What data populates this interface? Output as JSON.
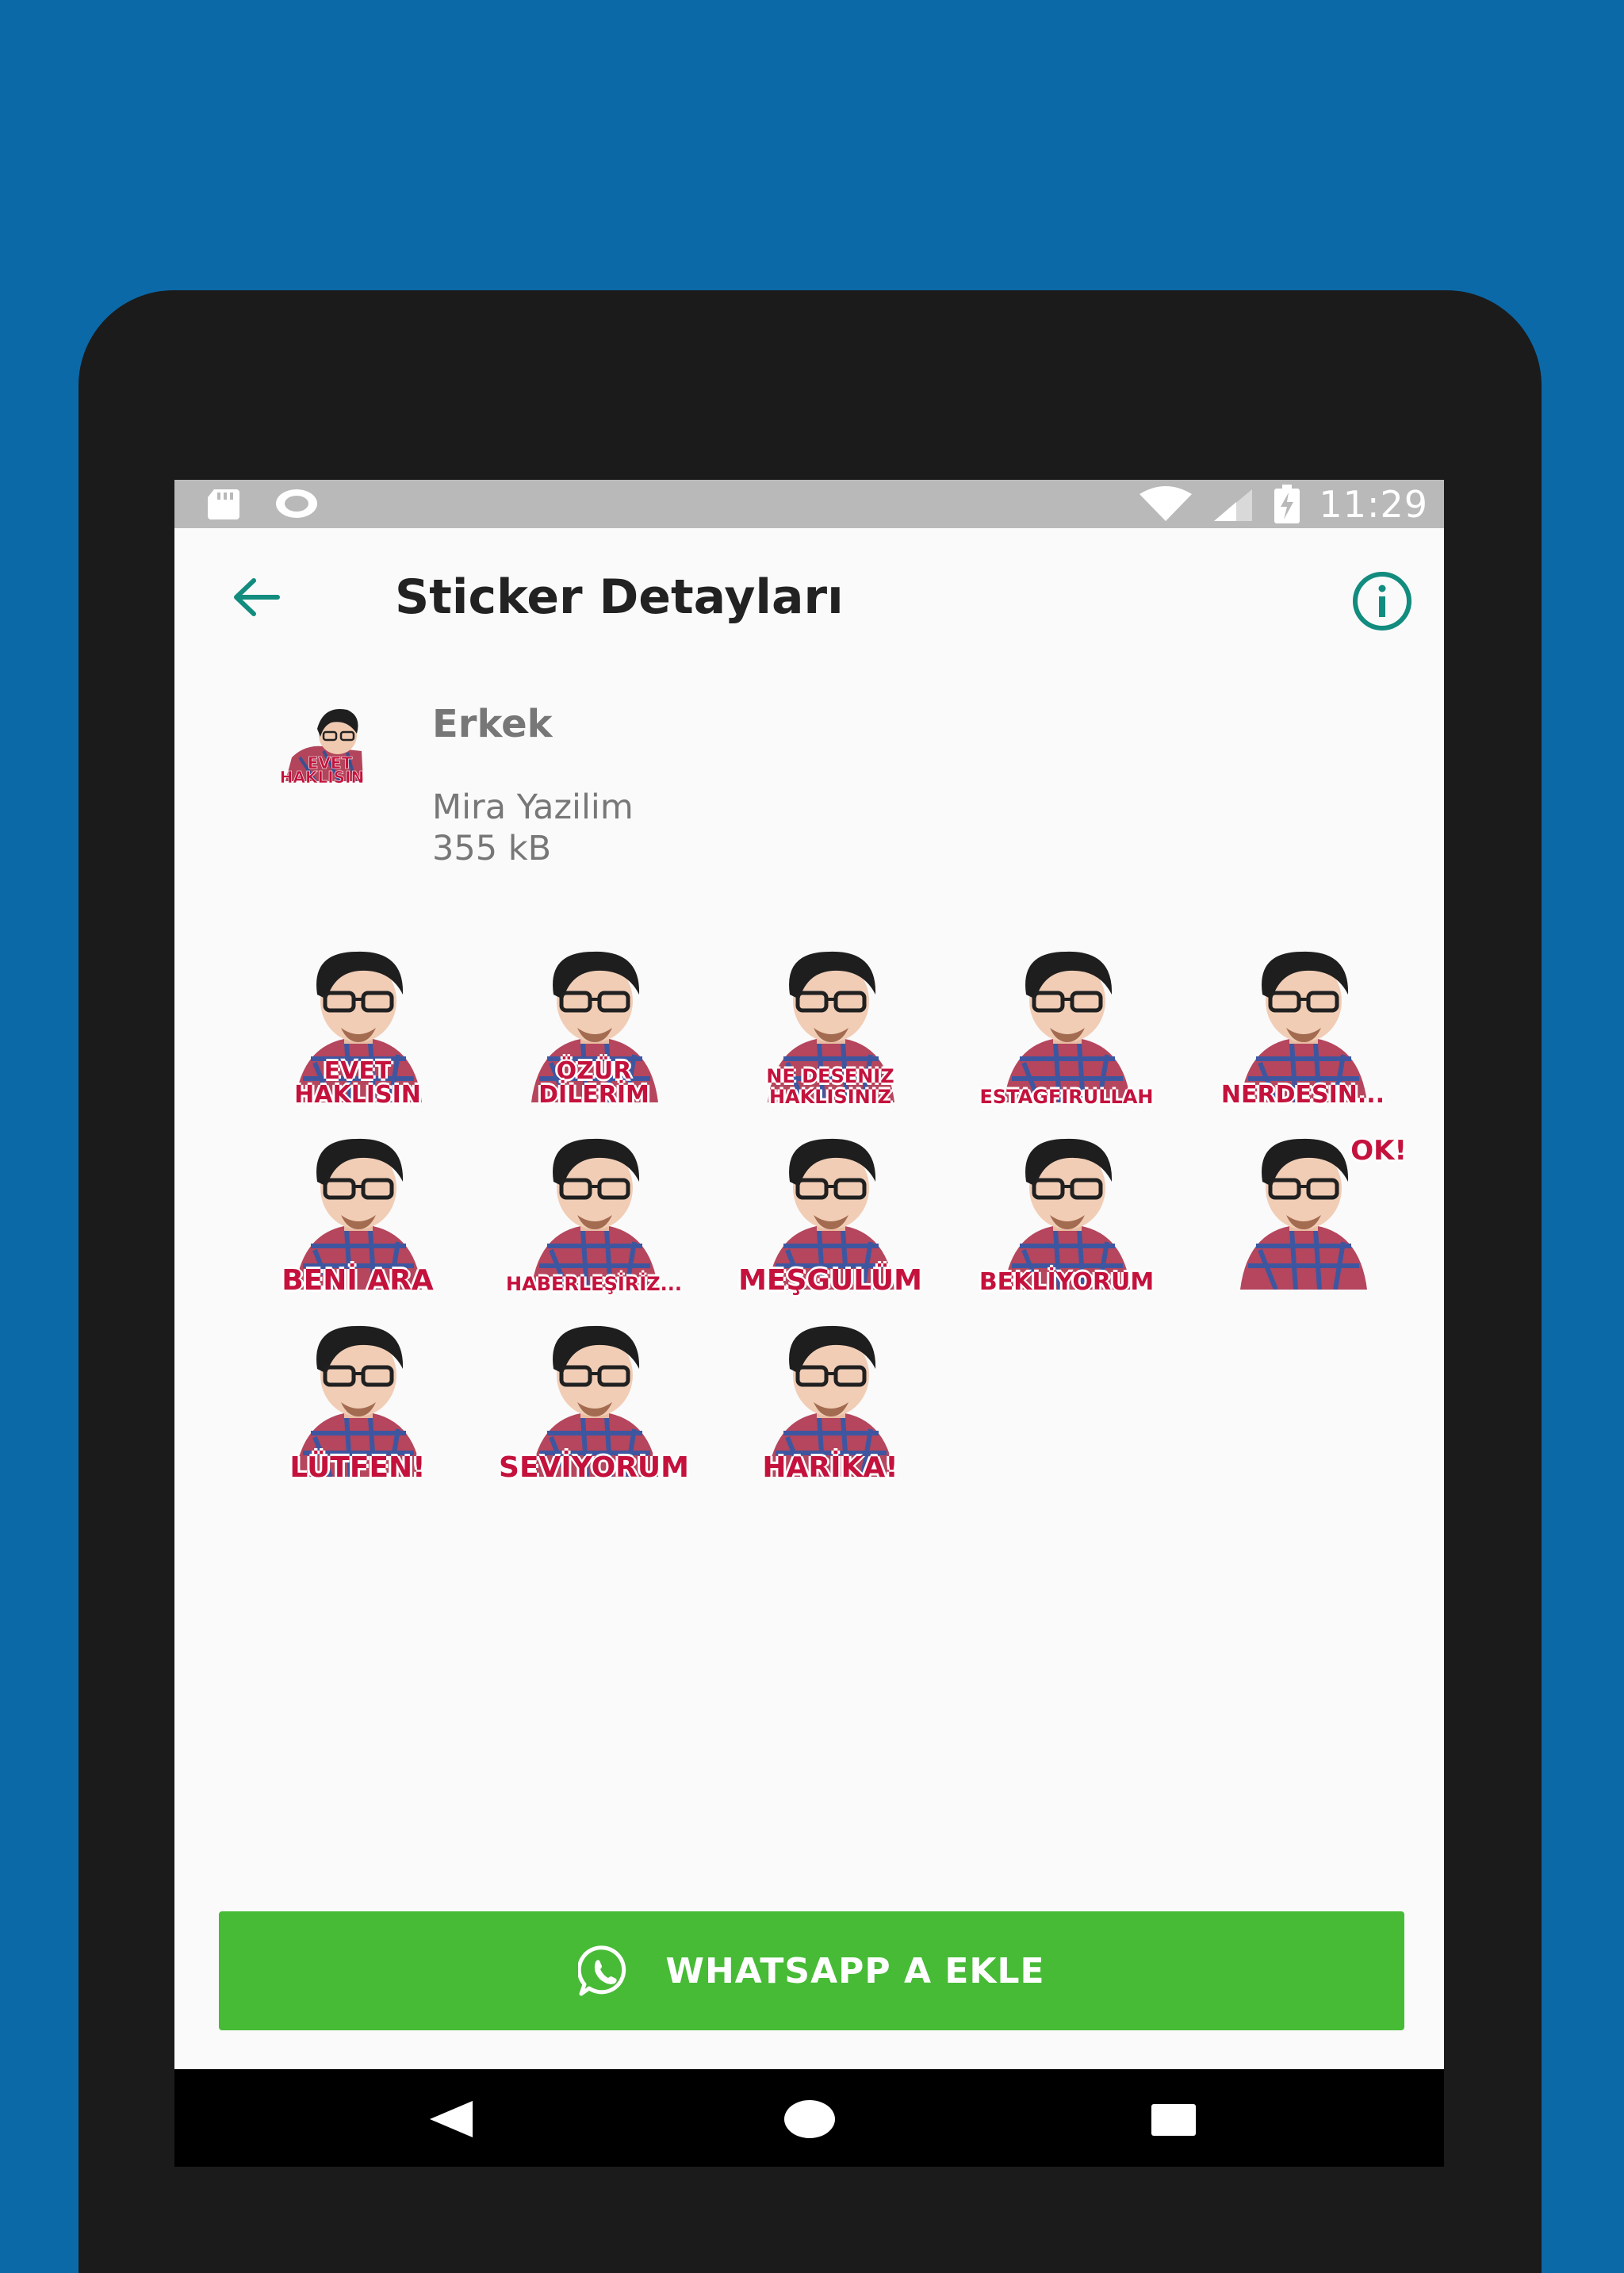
{
  "status_bar": {
    "time": "11:29",
    "left_icons": [
      "sd-card-icon",
      "circle-notification-icon"
    ],
    "right_icons": [
      "wifi-icon",
      "signal-icon",
      "battery-charging-icon"
    ]
  },
  "toolbar": {
    "title": "Sticker Detayları",
    "back_icon": "arrow-left-icon",
    "info_icon": "info-icon",
    "accent_color": "#128c7e"
  },
  "pack": {
    "name": "Erkek",
    "publisher": "Mira Yazilim",
    "size": "355 kB",
    "tray_caption_line1": "EVET",
    "tray_caption_line2": "HAKLISIN"
  },
  "stickers": [
    {
      "caption": "EVET\nHAKLISIN"
    },
    {
      "caption": "ÖZÜR\nDİLERİM"
    },
    {
      "caption": "NE DESENIZ\nHAKLISINIZ"
    },
    {
      "caption": "ESTAGFIRULLAH"
    },
    {
      "caption": "NERDESIN..."
    },
    {
      "caption": "BENİ ARA"
    },
    {
      "caption": "HABERLEŞİRİZ..."
    },
    {
      "caption": "MEŞGULÜM"
    },
    {
      "caption": "BEKLİYORUM"
    },
    {
      "caption": "OK!"
    },
    {
      "caption": "LÜTFEN!"
    },
    {
      "caption": "SEVİYORUM"
    },
    {
      "caption": "HARİKA!"
    }
  ],
  "add_button": {
    "label": "WHATSAPP A EKLE",
    "icon": "whatsapp-icon",
    "color": "#47bb36"
  },
  "nav_bar": {
    "buttons": [
      "nav-back-icon",
      "nav-home-icon",
      "nav-recents-icon"
    ]
  },
  "colors": {
    "background": "#0b69a8",
    "caption": "#c4123d"
  }
}
